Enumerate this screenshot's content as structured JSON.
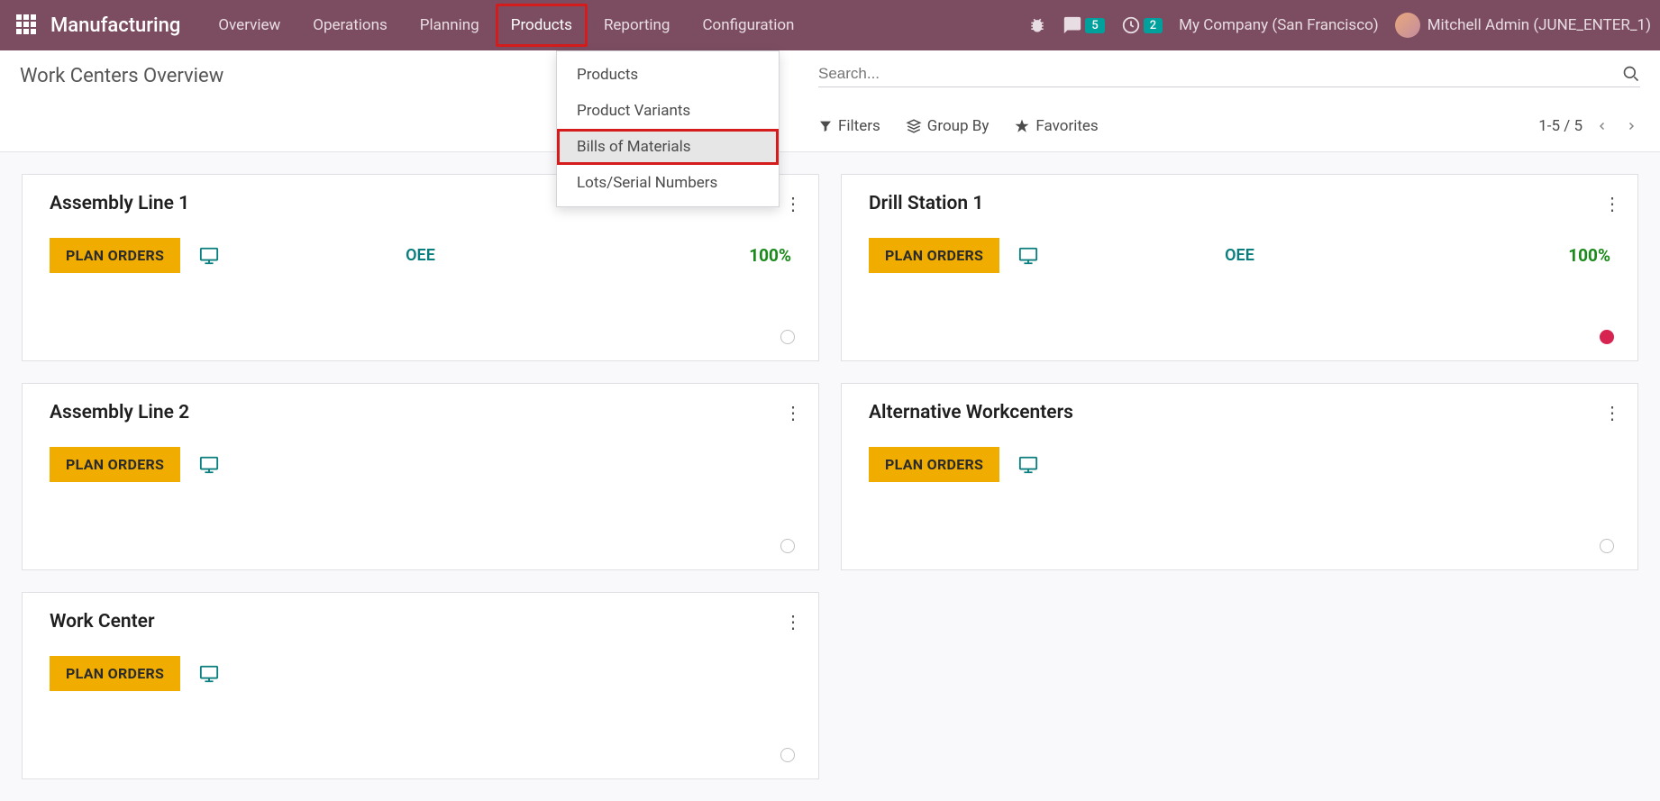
{
  "nav": {
    "brand": "Manufacturing",
    "items": [
      "Overview",
      "Operations",
      "Planning",
      "Products",
      "Reporting",
      "Configuration"
    ],
    "messages_badge": "5",
    "activities_badge": "2",
    "company": "My Company (San Francisco)",
    "user": "Mitchell Admin (JUNE_ENTER_1)"
  },
  "dropdown": {
    "items": [
      "Products",
      "Product Variants",
      "Bills of Materials",
      "Lots/Serial Numbers"
    ]
  },
  "page": {
    "title": "Work Centers Overview",
    "search_placeholder": "Search...",
    "filters": "Filters",
    "groupby": "Group By",
    "favorites": "Favorites",
    "pager": "1-5 / 5"
  },
  "cards": [
    {
      "title": "Assembly Line 1",
      "plan": "PLAN ORDERS",
      "oee_label": "OEE",
      "oee_value": "100%",
      "status": "grey"
    },
    {
      "title": "Drill Station 1",
      "plan": "PLAN ORDERS",
      "oee_label": "OEE",
      "oee_value": "100%",
      "status": "red"
    },
    {
      "title": "Assembly Line 2",
      "plan": "PLAN ORDERS",
      "status": "grey"
    },
    {
      "title": "Alternative Workcenters",
      "plan": "PLAN ORDERS",
      "status": "grey"
    },
    {
      "title": "Work Center",
      "plan": "PLAN ORDERS",
      "status": "grey"
    }
  ]
}
